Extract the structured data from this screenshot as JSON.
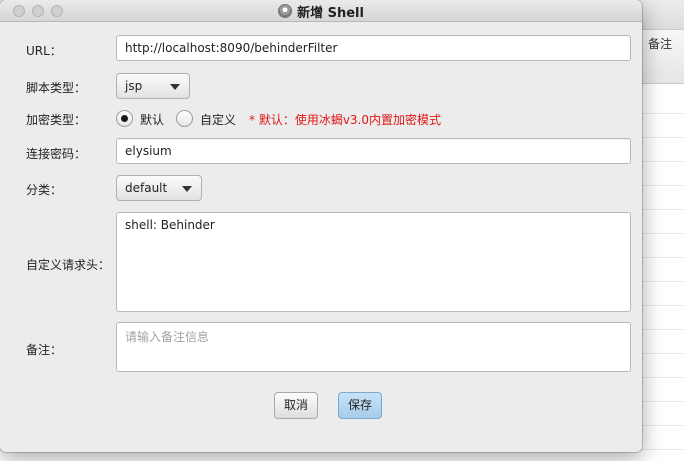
{
  "background": {
    "column_header": "备注",
    "row_count": 15
  },
  "dialog": {
    "title": "新增 Shell",
    "title_icon": "globe-icon",
    "url_label": "URL：",
    "url_value": "http://localhost:8090/behinderFilter",
    "script_type_label": "脚本类型：",
    "script_type_value": "jsp",
    "encryption_label": "加密类型：",
    "encryption_options": [
      {
        "label": "默认",
        "selected": true
      },
      {
        "label": "自定义",
        "selected": false
      }
    ],
    "encryption_hint": "* 默认：使用冰蝎v3.0内置加密模式",
    "password_label": "连接密码：",
    "password_value": "elysium",
    "category_label": "分类：",
    "category_value": "default",
    "headers_label": "自定义请求头：",
    "headers_value": "shell: Behinder",
    "remark_label": "备注：",
    "remark_placeholder": "请输入备注信息",
    "cancel_label": "取消",
    "save_label": "保存",
    "colors": {
      "hint": "#e01616",
      "primary_button": "#a6cdeb"
    }
  }
}
